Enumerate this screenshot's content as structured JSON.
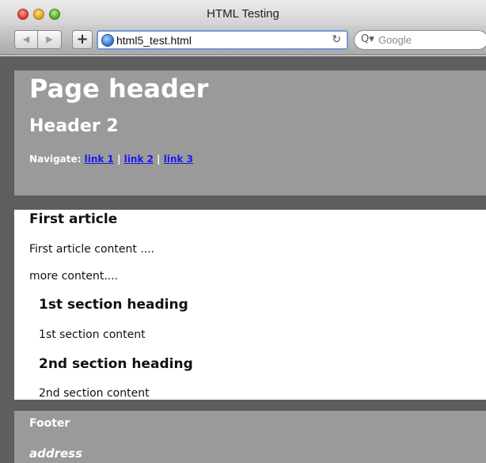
{
  "window": {
    "title": "HTML Testing"
  },
  "toolbar": {
    "back_icon": "◀",
    "forward_icon": "▶",
    "add_icon": "+",
    "url": "html5_test.html",
    "reload_icon": "↻",
    "search_icon": "Q▾",
    "search_placeholder": "Google"
  },
  "page": {
    "header": {
      "title": "Page header",
      "subtitle": "Header 2",
      "nav_label": "Navigate:",
      "links": [
        "link 1",
        "link 2",
        "link 3"
      ],
      "separator": "|"
    },
    "article": {
      "title": "First article",
      "paragraph1": "First article content ....",
      "paragraph2": "more content....",
      "section1": {
        "heading": "1st section heading",
        "content": "1st section content"
      },
      "section2": {
        "heading": "2nd section heading",
        "content": "2nd section content"
      }
    },
    "footer": {
      "label": "Footer",
      "address": "address"
    }
  }
}
